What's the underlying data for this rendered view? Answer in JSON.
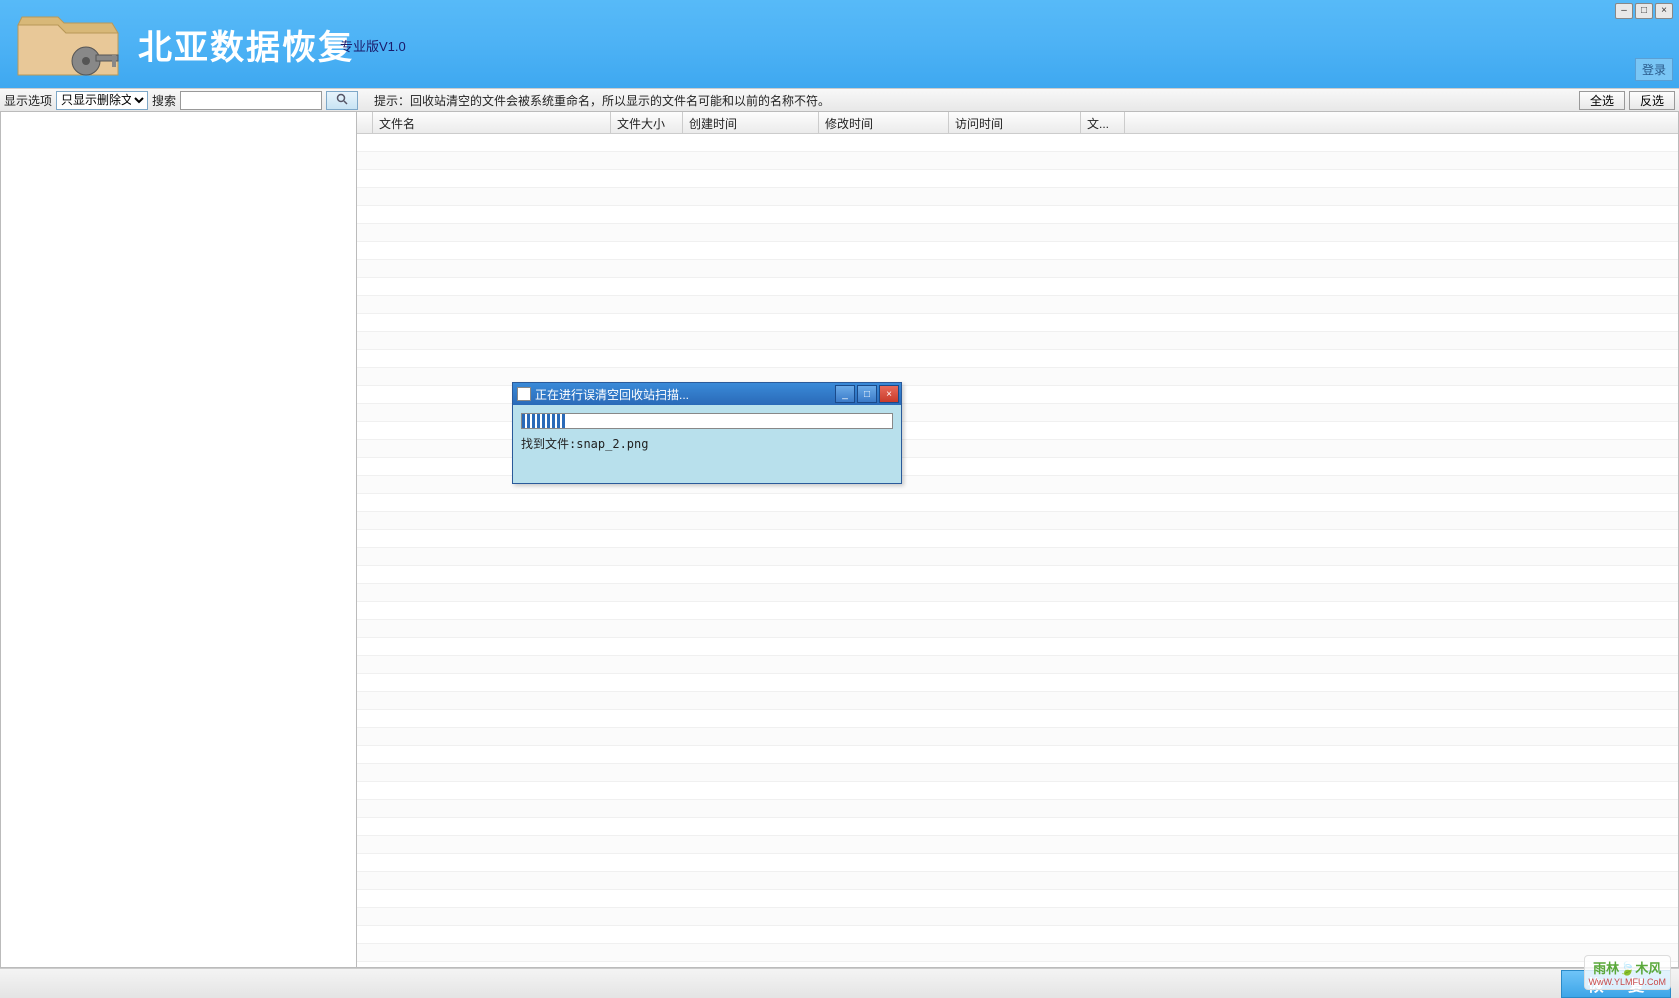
{
  "window": {
    "minimize": "–",
    "maximize": "□",
    "close": "×"
  },
  "header": {
    "app_title": "北亚数据恢复",
    "version": "专业版V1.0",
    "login": "登录"
  },
  "toolbar": {
    "display_label": "显示选项",
    "display_value": "只显示删除文件",
    "search_label": "搜索",
    "search_value": "",
    "hint": "提示：回收站清空的文件会被系统重命名，所以显示的文件名可能和以前的名称不符。",
    "select_all": "全选",
    "invert_select": "反选"
  },
  "columns": {
    "name": "文件名",
    "size": "文件大小",
    "ctime": "创建时间",
    "mtime": "修改时间",
    "atime": "访问时间",
    "ext": "文..."
  },
  "modal": {
    "title": "正在进行误清空回收站扫描...",
    "status_prefix": "找到文件:",
    "status_file": "snap_2.png",
    "min": "_",
    "max": "□",
    "close": "×"
  },
  "bottom": {
    "recover": "恢 复"
  },
  "watermark": {
    "title": "雨林🍃木风",
    "url": "WwW.YLMFU.CoM"
  }
}
